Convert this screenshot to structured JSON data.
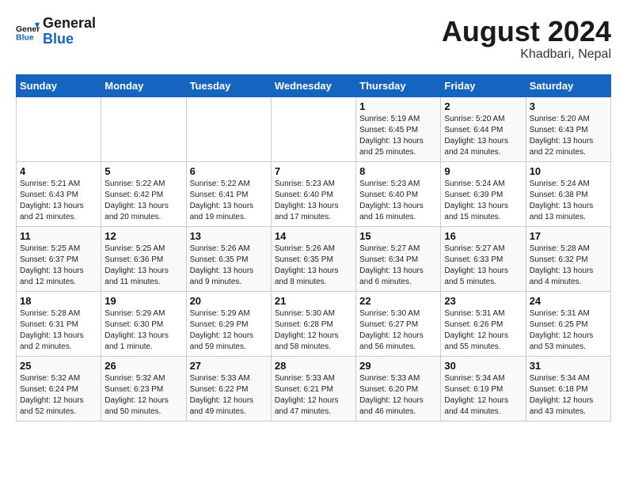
{
  "header": {
    "logo_general": "General",
    "logo_blue": "Blue",
    "month": "August 2024",
    "location": "Khadbari, Nepal"
  },
  "days_of_week": [
    "Sunday",
    "Monday",
    "Tuesday",
    "Wednesday",
    "Thursday",
    "Friday",
    "Saturday"
  ],
  "weeks": [
    [
      {
        "day": "",
        "info": ""
      },
      {
        "day": "",
        "info": ""
      },
      {
        "day": "",
        "info": ""
      },
      {
        "day": "",
        "info": ""
      },
      {
        "day": "1",
        "info": "Sunrise: 5:19 AM\nSunset: 6:45 PM\nDaylight: 13 hours\nand 25 minutes."
      },
      {
        "day": "2",
        "info": "Sunrise: 5:20 AM\nSunset: 6:44 PM\nDaylight: 13 hours\nand 24 minutes."
      },
      {
        "day": "3",
        "info": "Sunrise: 5:20 AM\nSunset: 6:43 PM\nDaylight: 13 hours\nand 22 minutes."
      }
    ],
    [
      {
        "day": "4",
        "info": "Sunrise: 5:21 AM\nSunset: 6:43 PM\nDaylight: 13 hours\nand 21 minutes."
      },
      {
        "day": "5",
        "info": "Sunrise: 5:22 AM\nSunset: 6:42 PM\nDaylight: 13 hours\nand 20 minutes."
      },
      {
        "day": "6",
        "info": "Sunrise: 5:22 AM\nSunset: 6:41 PM\nDaylight: 13 hours\nand 19 minutes."
      },
      {
        "day": "7",
        "info": "Sunrise: 5:23 AM\nSunset: 6:40 PM\nDaylight: 13 hours\nand 17 minutes."
      },
      {
        "day": "8",
        "info": "Sunrise: 5:23 AM\nSunset: 6:40 PM\nDaylight: 13 hours\nand 16 minutes."
      },
      {
        "day": "9",
        "info": "Sunrise: 5:24 AM\nSunset: 6:39 PM\nDaylight: 13 hours\nand 15 minutes."
      },
      {
        "day": "10",
        "info": "Sunrise: 5:24 AM\nSunset: 6:38 PM\nDaylight: 13 hours\nand 13 minutes."
      }
    ],
    [
      {
        "day": "11",
        "info": "Sunrise: 5:25 AM\nSunset: 6:37 PM\nDaylight: 13 hours\nand 12 minutes."
      },
      {
        "day": "12",
        "info": "Sunrise: 5:25 AM\nSunset: 6:36 PM\nDaylight: 13 hours\nand 11 minutes."
      },
      {
        "day": "13",
        "info": "Sunrise: 5:26 AM\nSunset: 6:35 PM\nDaylight: 13 hours\nand 9 minutes."
      },
      {
        "day": "14",
        "info": "Sunrise: 5:26 AM\nSunset: 6:35 PM\nDaylight: 13 hours\nand 8 minutes."
      },
      {
        "day": "15",
        "info": "Sunrise: 5:27 AM\nSunset: 6:34 PM\nDaylight: 13 hours\nand 6 minutes."
      },
      {
        "day": "16",
        "info": "Sunrise: 5:27 AM\nSunset: 6:33 PM\nDaylight: 13 hours\nand 5 minutes."
      },
      {
        "day": "17",
        "info": "Sunrise: 5:28 AM\nSunset: 6:32 PM\nDaylight: 13 hours\nand 4 minutes."
      }
    ],
    [
      {
        "day": "18",
        "info": "Sunrise: 5:28 AM\nSunset: 6:31 PM\nDaylight: 13 hours\nand 2 minutes."
      },
      {
        "day": "19",
        "info": "Sunrise: 5:29 AM\nSunset: 6:30 PM\nDaylight: 13 hours\nand 1 minute."
      },
      {
        "day": "20",
        "info": "Sunrise: 5:29 AM\nSunset: 6:29 PM\nDaylight: 12 hours\nand 59 minutes."
      },
      {
        "day": "21",
        "info": "Sunrise: 5:30 AM\nSunset: 6:28 PM\nDaylight: 12 hours\nand 58 minutes."
      },
      {
        "day": "22",
        "info": "Sunrise: 5:30 AM\nSunset: 6:27 PM\nDaylight: 12 hours\nand 56 minutes."
      },
      {
        "day": "23",
        "info": "Sunrise: 5:31 AM\nSunset: 6:26 PM\nDaylight: 12 hours\nand 55 minutes."
      },
      {
        "day": "24",
        "info": "Sunrise: 5:31 AM\nSunset: 6:25 PM\nDaylight: 12 hours\nand 53 minutes."
      }
    ],
    [
      {
        "day": "25",
        "info": "Sunrise: 5:32 AM\nSunset: 6:24 PM\nDaylight: 12 hours\nand 52 minutes."
      },
      {
        "day": "26",
        "info": "Sunrise: 5:32 AM\nSunset: 6:23 PM\nDaylight: 12 hours\nand 50 minutes."
      },
      {
        "day": "27",
        "info": "Sunrise: 5:33 AM\nSunset: 6:22 PM\nDaylight: 12 hours\nand 49 minutes."
      },
      {
        "day": "28",
        "info": "Sunrise: 5:33 AM\nSunset: 6:21 PM\nDaylight: 12 hours\nand 47 minutes."
      },
      {
        "day": "29",
        "info": "Sunrise: 5:33 AM\nSunset: 6:20 PM\nDaylight: 12 hours\nand 46 minutes."
      },
      {
        "day": "30",
        "info": "Sunrise: 5:34 AM\nSunset: 6:19 PM\nDaylight: 12 hours\nand 44 minutes."
      },
      {
        "day": "31",
        "info": "Sunrise: 5:34 AM\nSunset: 6:18 PM\nDaylight: 12 hours\nand 43 minutes."
      }
    ]
  ]
}
